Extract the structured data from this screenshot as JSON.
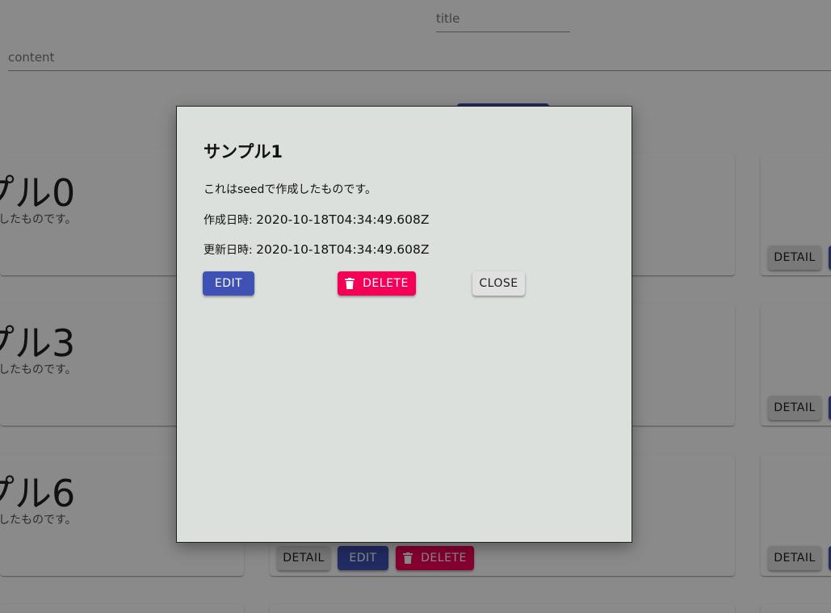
{
  "form": {
    "title_placeholder": "title",
    "content_placeholder": "content"
  },
  "cards": [
    {
      "title": "プル0",
      "body": "作成したものです。",
      "detail_label": "DETAIL"
    },
    {
      "title": "プル3",
      "body": "作成したものです。",
      "detail_label": "DETAIL"
    },
    {
      "title": "プル6",
      "body": "作成したものです。",
      "detail_label": "DETAIL"
    }
  ],
  "card_buttons": {
    "detail_label": "DETAIL",
    "edit_label": "EDIT",
    "delete_label": "DELETE"
  },
  "modal": {
    "title": "サンプル1",
    "body": "これはseedで作成したものです。",
    "created_label": "作成日時: ",
    "created_value": "2020-10-18T04:34:49.608Z",
    "updated_label": "更新日時: ",
    "updated_value": "2020-10-18T04:34:49.608Z",
    "edit_label": "EDIT",
    "delete_label": "DELETE",
    "close_label": "CLOSE"
  },
  "colors": {
    "primary": "#3f51b5",
    "secondary": "#f50057",
    "modal_background": "#dce0dc",
    "default_button": "#e0e0e0"
  },
  "icons": {
    "delete": "trash-icon"
  }
}
